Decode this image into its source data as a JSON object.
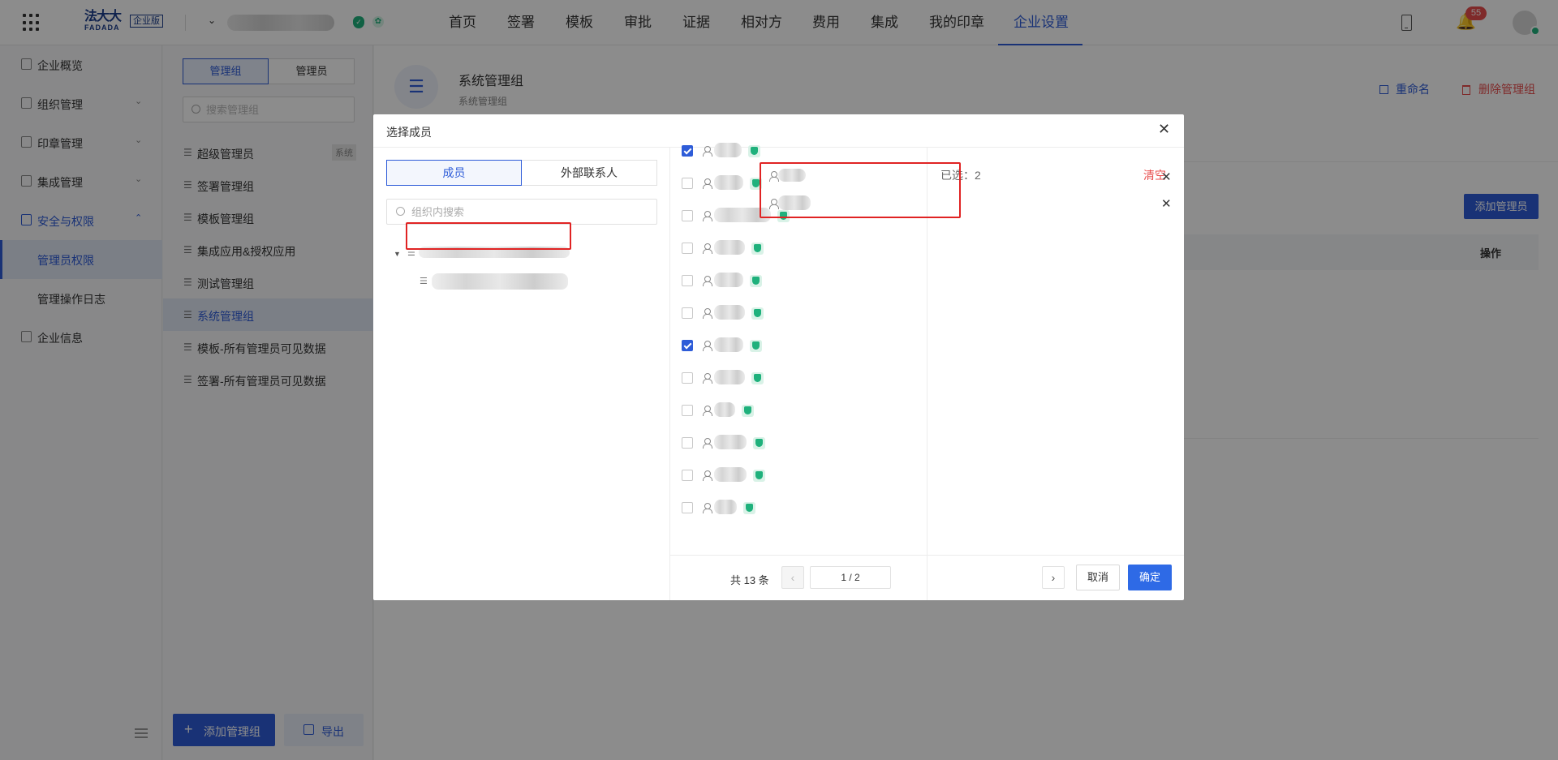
{
  "header": {
    "logo_cn": "法大大",
    "logo_en": "FADADA",
    "edition": "企业版",
    "nav": [
      "首页",
      "签署",
      "模板",
      "审批",
      "证据",
      "相对方",
      "费用",
      "集成",
      "我的印章",
      "企业设置"
    ],
    "active_nav": "企业设置",
    "notification_count": "55"
  },
  "sidebar": {
    "items": [
      "企业概览",
      "组织管理",
      "印章管理",
      "集成管理",
      "安全与权限"
    ],
    "sub_items": [
      "管理员权限",
      "管理操作日志"
    ],
    "last_item": "企业信息"
  },
  "groups_panel": {
    "tabs": [
      "管理组",
      "管理员"
    ],
    "search_placeholder": "搜索管理组",
    "groups": [
      "超级管理员",
      "签署管理组",
      "模板管理组",
      "集成应用&授权应用",
      "测试管理组",
      "系统管理组",
      "模板-所有管理员可见数据",
      "签署-所有管理员可见数据"
    ],
    "system_tag": "系统",
    "add_group": "添加管理组",
    "export": "导出"
  },
  "main": {
    "group_title": "系统管理组",
    "group_subtitle": "系统管理组",
    "rename": "重命名",
    "delete": "删除管理组",
    "add_admin": "添加管理员",
    "col_action": "操作"
  },
  "modal": {
    "title": "选择成员",
    "tabs": [
      "成员",
      "外部联系人"
    ],
    "search_placeholder": "组织内搜索",
    "pagination": {
      "total": "共 13 条",
      "page": "1 / 2"
    },
    "selected_label": "已选：2",
    "clear": "清空",
    "cancel": "取消",
    "confirm": "确定"
  },
  "colors": {
    "primary": "#2e5cd8",
    "danger": "#e84d4d",
    "verified": "#1fb17c",
    "highlight": "#e02323"
  }
}
